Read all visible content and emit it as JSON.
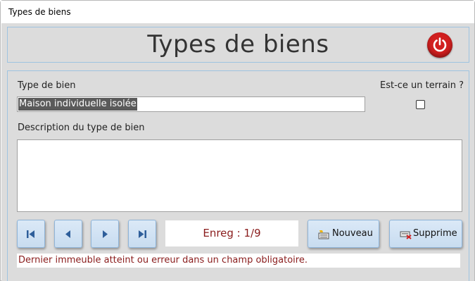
{
  "window": {
    "title": "Types de biens"
  },
  "header": {
    "title": "Types de biens",
    "close_icon": "power-icon",
    "close_color": "#d21f1f"
  },
  "fields": {
    "type_label": "Type de bien",
    "type_value": "Maison individuelle isolée",
    "terrain_label": "Est-ce un terrain ?",
    "terrain_checked": false,
    "description_label": "Description du type de bien",
    "description_value": ""
  },
  "navigation": {
    "first_icon": "first-record-icon",
    "prev_icon": "previous-record-icon",
    "next_icon": "next-record-icon",
    "last_icon": "last-record-icon",
    "record_counter": "Enreg : 1/9"
  },
  "actions": {
    "new_label": "Nouveau",
    "delete_label": "Supprime"
  },
  "status": {
    "message": "Dernier immeuble atteint ou erreur dans un champ obligatoire."
  },
  "colors": {
    "accent_border": "#9ec3e0",
    "button_bg": "#c8dcf0",
    "error_text": "#8a1c1c"
  }
}
